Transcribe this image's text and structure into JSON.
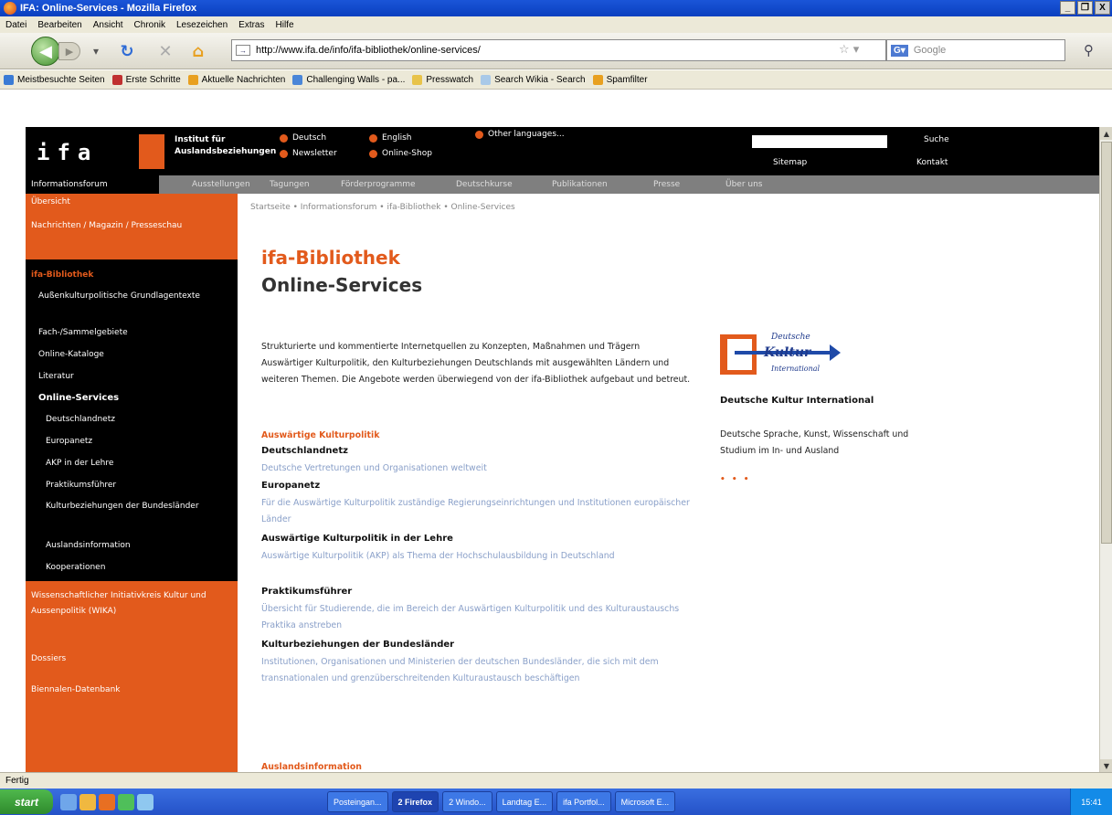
{
  "window": {
    "title": "IFA: Online-Services - Mozilla Firefox",
    "buttons": {
      "minimize": "_",
      "maximize": "❐",
      "close": "X"
    }
  },
  "menubar": [
    "Datei",
    "Bearbeiten",
    "Ansicht",
    "Chronik",
    "Lesezeichen",
    "Extras",
    "Hilfe"
  ],
  "navbar": {
    "url": "http://www.ifa.de/info/ifa-bibliothek/online-services/",
    "search_placeholder": "Google"
  },
  "bookmarks": [
    {
      "label": "Meistbesuchte Seiten",
      "color": "#3a7bd5"
    },
    {
      "label": "Erste Schritte",
      "color": "#c03030"
    },
    {
      "label": "Aktuelle Nachrichten",
      "color": "#e8a020"
    },
    {
      "label": "Challenging Walls - pa...",
      "color": "#4a86d8"
    },
    {
      "label": "Presswatch",
      "color": "#e8c34a"
    },
    {
      "label": "Search Wikia - Search",
      "color": "#a9c9e8"
    },
    {
      "label": "Spamfilter",
      "color": "#e8a020"
    }
  ],
  "site": {
    "logo": "ifa",
    "institute_line1": "Institut für",
    "institute_line2": "Auslandsbeziehungen",
    "lang_de": "Deutsch",
    "lang_en": "English",
    "lang_other": "Other languages...",
    "newsletter": "Newsletter",
    "shop": "Online-Shop",
    "search": "Suche",
    "sitemap": "Sitemap",
    "contact": "Kontakt",
    "accent": "#e25a1c"
  },
  "mainnav": [
    "Informationsforum",
    "Ausstellungen",
    "Tagungen",
    "Förderprogramme",
    "Deutschkurse",
    "Publikationen",
    "Presse",
    "Über uns"
  ],
  "sidebar": [
    {
      "label": "Übersicht",
      "style": "orange"
    },
    {
      "label": "Nachrichten / Magazin / Presseschau",
      "style": "orange"
    },
    {
      "label": "ifa-Bibliothek",
      "style": "head"
    },
    {
      "label": "Außenkulturpolitische Grundlagentexte",
      "style": "sub"
    },
    {
      "label": "Fach-/Sammelgebiete",
      "style": "sub"
    },
    {
      "label": "Online-Kataloge",
      "style": "sub"
    },
    {
      "label": "Literatur",
      "style": "sub"
    },
    {
      "label": "Online-Services",
      "style": "active"
    },
    {
      "label": "Deutschlandnetz",
      "style": "sub2"
    },
    {
      "label": "Europanetz",
      "style": "sub2"
    },
    {
      "label": "AKP in der Lehre",
      "style": "sub2"
    },
    {
      "label": "Praktikumsführer",
      "style": "sub2"
    },
    {
      "label": "Kulturbeziehungen der Bundesländer",
      "style": "sub2"
    },
    {
      "label": "Auslandsinformation",
      "style": "sub2"
    },
    {
      "label": "Kooperationen",
      "style": "sub2"
    },
    {
      "label": "Wissenschaftlicher Initiativkreis Kultur und Aussenpolitik (WIKA)",
      "style": "orange"
    },
    {
      "label": "Dossiers",
      "style": "orange"
    },
    {
      "label": "Biennalen-Datenbank",
      "style": "orange"
    }
  ],
  "main": {
    "breadcrumb": "Startseite • Informationsforum • ifa-Bibliothek • Online-Services",
    "title1": "ifa-Bibliothek",
    "title2": "Online-Services",
    "intro": "Strukturierte und kommentierte Internetquellen zu Konzepten, Maßnahmen und Trägern Auswärtiger Kulturpolitik, den Kulturbeziehungen Deutschlands mit ausgewählten Ländern und weiteren Themen. Die Angebote werden überwiegend von der ifa-Bibliothek aufgebaut und betreut.",
    "section": "Auswärtige Kulturpolitik",
    "entries": [
      {
        "title": "Deutschlandnetz",
        "desc": "Deutsche Vertretungen und Organisationen weltweit"
      },
      {
        "title": "Europanetz",
        "desc": "Für die Auswärtige Kulturpolitik zuständige Regierungseinrichtungen und Institutionen europäischer Länder"
      },
      {
        "title": "Auswärtige Kulturpolitik in der Lehre",
        "desc": "Auswärtige Kulturpolitik (AKP) als Thema der Hochschulausbildung in Deutschland"
      },
      {
        "title": "Praktikumsführer",
        "desc": "Übersicht für Studierende, die im Bereich der Auswärtigen Kulturpolitik und des Kulturaustauschs Praktika anstreben"
      },
      {
        "title": "Kulturbeziehungen der Bundesländer",
        "desc": "Institutionen, Organisationen und Ministerien der deutschen Bundesländer, die sich mit dem transnationalen und grenzüberschreitenden Kulturaustausch beschäftigen"
      }
    ],
    "next_section": "Auslandsinformation"
  },
  "dki": {
    "logo_top": "Deutsche",
    "logo_mid": "Kultur",
    "logo_bottom": "International",
    "title": "Deutsche Kultur International",
    "desc": "Deutsche Sprache, Kunst, Wissenschaft und Studium im In- und Ausland",
    "more": "• • •"
  },
  "status": "Fertig",
  "taskbar": {
    "start": "start",
    "tasks": [
      "Posteingan...",
      "2 Firefox",
      "2 Windo...",
      "Landtag E...",
      "ifa Portfol...",
      "Microsoft E..."
    ],
    "clock": "15:41"
  }
}
